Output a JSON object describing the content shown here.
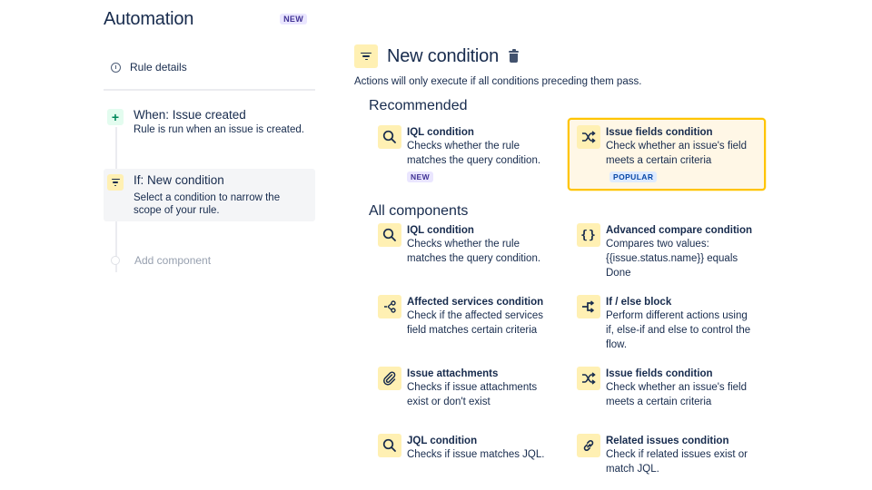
{
  "sidebar": {
    "app_title": "Automation",
    "app_badge": "NEW",
    "rule_details_label": "Rule details",
    "steps": [
      {
        "title": "When: Issue created",
        "description": "Rule is run when an issue is created.",
        "icon": "plus-icon",
        "icon_color": "#00875A",
        "active": false
      },
      {
        "title": "If: New condition",
        "description": "Select a condition to narrow the scope of your rule.",
        "icon": "filter-icon",
        "icon_color": "#FFF0B3",
        "active": true
      }
    ],
    "add_component_label": "Add component"
  },
  "main": {
    "title": "New condition",
    "subtitle": "Actions will only execute if all conditions preceding them pass.",
    "recommended": {
      "heading": "Recommended",
      "items": [
        {
          "title": "IQL condition",
          "description": "Checks whether the rule matches the query condition.",
          "icon": "search-icon",
          "badge": "NEW"
        },
        {
          "title": "Issue fields condition",
          "description": "Check whether an issue's field meets a certain criteria",
          "icon": "shuffle-icon",
          "badge": "POPULAR",
          "selected": true
        }
      ]
    },
    "all_components": {
      "heading": "All components",
      "items": [
        {
          "title": "IQL condition",
          "description": "Checks whether the rule matches the query condition.",
          "icon": "search-icon"
        },
        {
          "title": "Advanced compare condition",
          "description": "Compares two values: {{issue.status.name}} equals Done",
          "icon": "braces-icon"
        },
        {
          "title": "Affected services condition",
          "description": "Check if the affected services field matches certain criteria",
          "icon": "share-nodes-icon"
        },
        {
          "title": "If / else block",
          "description": "Perform different actions using if, else-if and else to control the flow.",
          "icon": "branch-icon"
        },
        {
          "title": "Issue attachments",
          "description": "Checks if issue attachments exist or don't exist",
          "icon": "paperclip-icon"
        },
        {
          "title": "Issue fields condition",
          "description": "Check whether an issue's field meets a certain criteria",
          "icon": "shuffle-icon"
        },
        {
          "title": "JQL condition",
          "description": "Checks if issue matches JQL.",
          "icon": "search-icon"
        },
        {
          "title": "Related issues condition",
          "description": "Check if related issues exist or match JQL.",
          "icon": "link-icon"
        }
      ]
    }
  },
  "colors": {
    "text_primary": "#172B4D",
    "icon_bg_yellow": "#FFF0B3",
    "highlight_border": "#FFC400",
    "highlight_bg": "#FFF7E6",
    "badge_new_bg": "#EAE6FF",
    "badge_popular_bg": "#DEEBFF"
  }
}
